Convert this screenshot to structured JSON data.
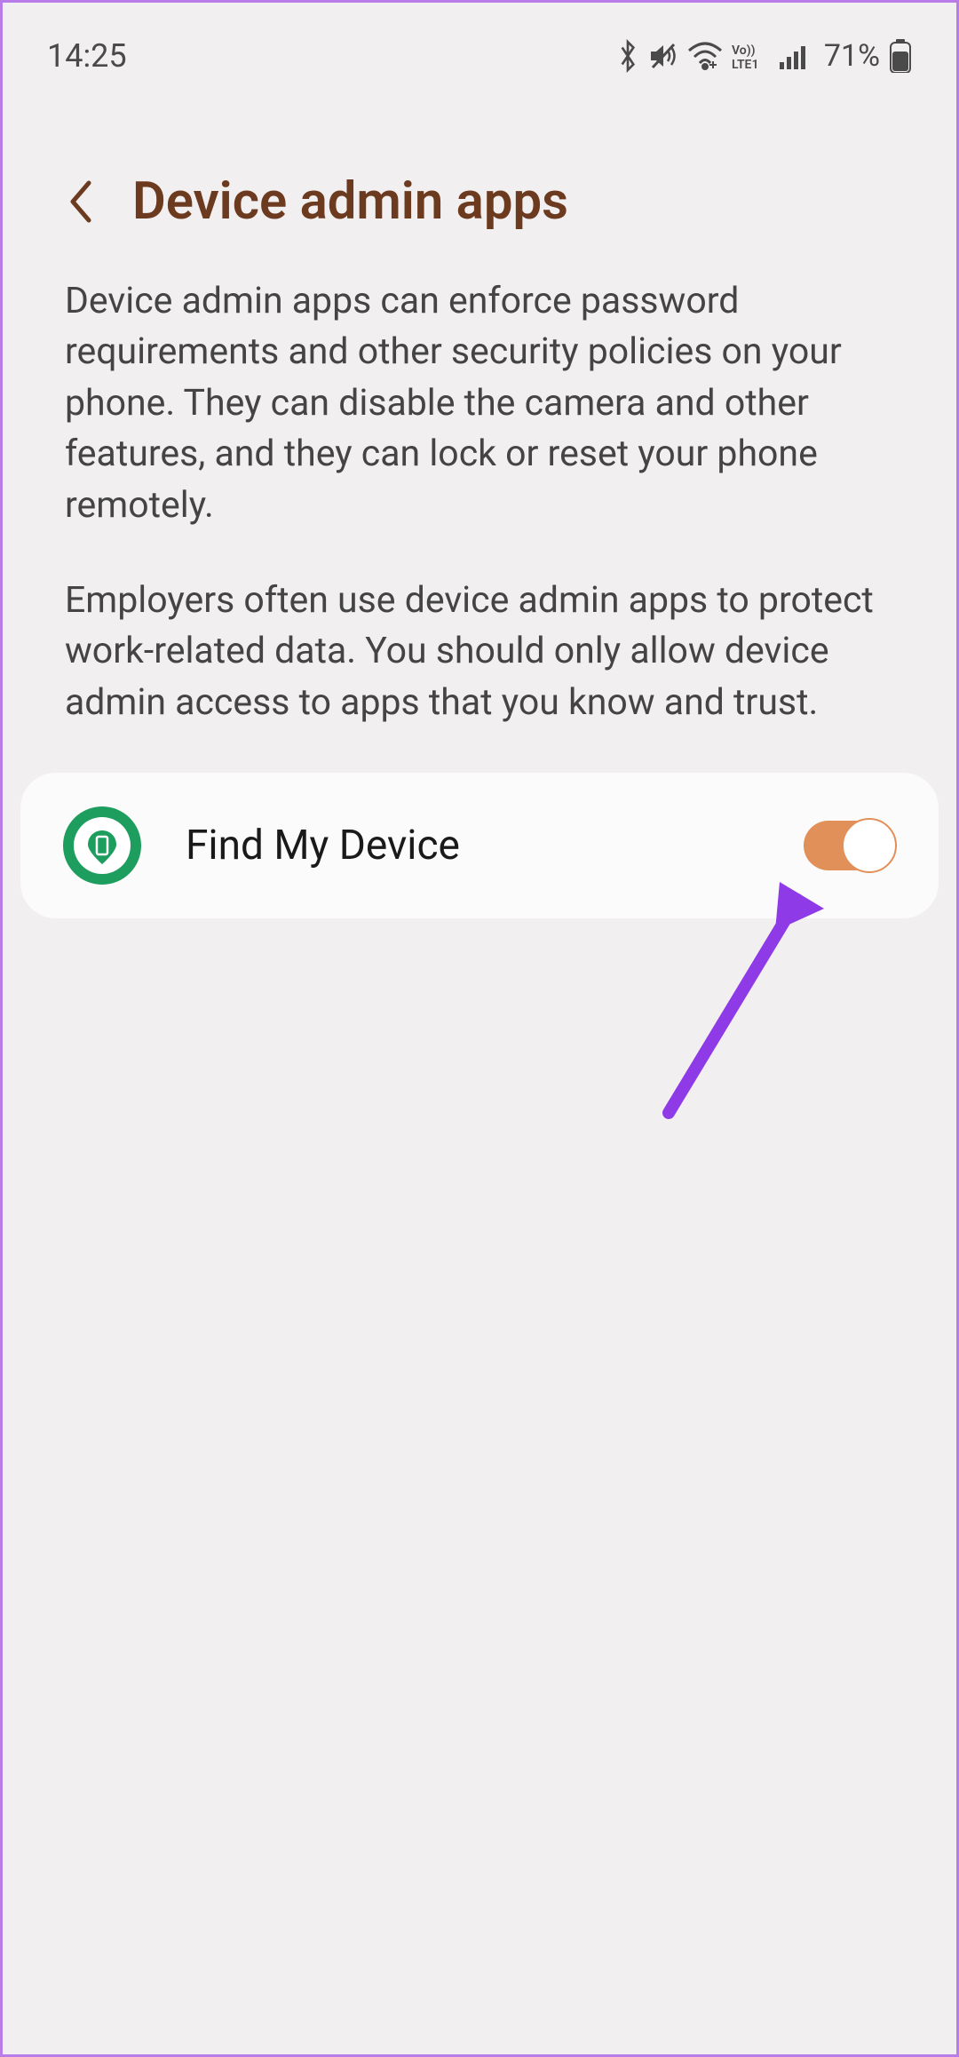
{
  "status": {
    "time": "14:25",
    "battery_pct": "71%"
  },
  "header": {
    "title": "Device admin apps"
  },
  "description": {
    "p1": "Device admin apps can enforce password requirements and other security policies on your phone. They can disable the camera and other features, and they can lock or reset your phone remotely.",
    "p2": "Employers often use device admin apps to protect work-related data. You should only allow device admin access to apps that you know and trust."
  },
  "apps": [
    {
      "name": "Find My Device",
      "enabled": true
    }
  ]
}
